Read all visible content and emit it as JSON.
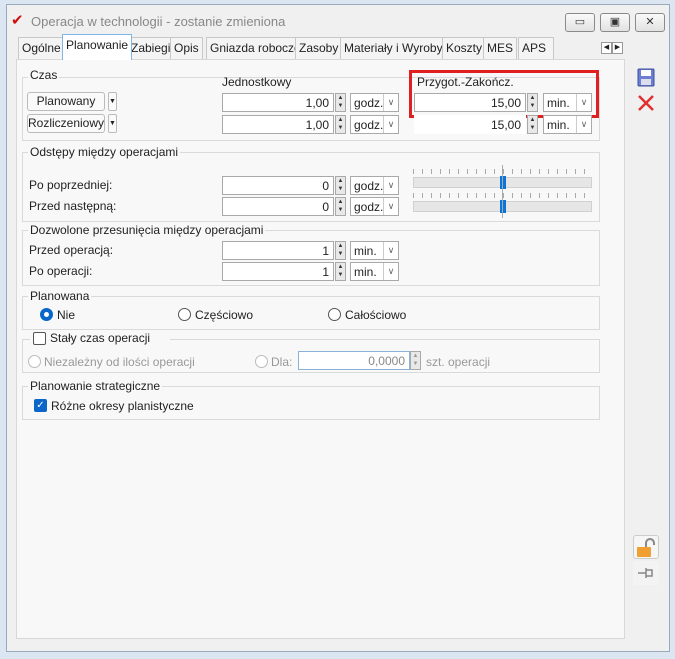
{
  "window": {
    "title": "Operacja w technologii - zostanie zmieniona",
    "minimize": "▭",
    "maximize": "▣",
    "close": "✕"
  },
  "tabs": [
    "Ogólne",
    "Planowanie",
    "Zabiegi",
    "Opis",
    "Gniazda robocze",
    "Zasoby",
    "Materiały i Wyroby",
    "Koszty",
    "MES",
    "APS"
  ],
  "active_tab": "Planowanie",
  "czas": {
    "label": "Czas",
    "col1": "Jednostkowy",
    "col2": "Przygot.-Zakończ.",
    "rows": [
      {
        "button": "Planowany",
        "val1": "1,00",
        "unit1": "godz.",
        "val2": "15,00",
        "unit2": "min."
      },
      {
        "button": "Rozliczeniowy",
        "val1": "1,00",
        "unit1": "godz.",
        "val2": "15,00",
        "unit2": "min."
      }
    ]
  },
  "odstepy": {
    "label": "Odstępy między operacjami",
    "rows": [
      {
        "label": "Po poprzedniej:",
        "value": "0",
        "unit": "godz."
      },
      {
        "label": "Przed następną:",
        "value": "0",
        "unit": "godz."
      }
    ],
    "slider_position": 0.5
  },
  "dozwolone": {
    "label": "Dozwolone przesunięcia między operacjami",
    "rows": [
      {
        "label": "Przed operacją:",
        "value": "1",
        "unit": "min."
      },
      {
        "label": "Po operacji:",
        "value": "1",
        "unit": "min."
      }
    ]
  },
  "planowana": {
    "label": "Planowana",
    "options": [
      "Nie",
      "Częściowo",
      "Całościowo"
    ],
    "selected": "Nie"
  },
  "staly": {
    "label": "Stały czas operacji",
    "checked": false,
    "opt1": "Niezależny od ilości operacji",
    "opt2": "Dla:",
    "value": "0,0000",
    "suffix": "szt. operacji"
  },
  "strategiczne": {
    "label": "Planowanie strategiczne",
    "checkbox": "Różne okresy planistyczne",
    "checked": true
  },
  "colors": {
    "accent": "#0a66c8",
    "highlight": "#e02020"
  }
}
